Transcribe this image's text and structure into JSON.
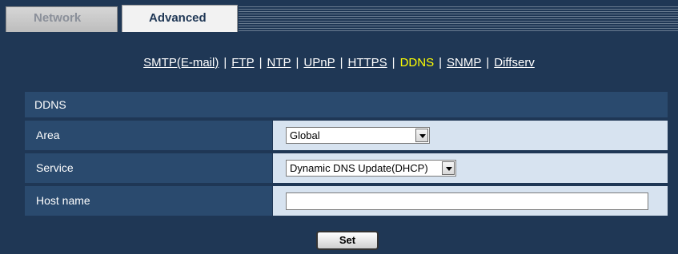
{
  "tabs": {
    "network": "Network",
    "advanced": "Advanced"
  },
  "nav": {
    "links": [
      "SMTP(E-mail)",
      "FTP",
      "NTP",
      "UPnP",
      "HTTPS",
      "DDNS",
      "SNMP",
      "Diffserv"
    ],
    "active": "DDNS",
    "separator": "|"
  },
  "section": {
    "title": "DDNS"
  },
  "form": {
    "area_label": "Area",
    "area_value": "Global",
    "service_label": "Service",
    "service_value": "Dynamic DNS Update(DHCP)",
    "hostname_label": "Host name",
    "hostname_value": ""
  },
  "buttons": {
    "set": "Set"
  },
  "colors": {
    "background": "#1f3755",
    "row_label": "#2a4a6e",
    "row_value": "#d7e3f0",
    "active_link": "#ffff00"
  }
}
